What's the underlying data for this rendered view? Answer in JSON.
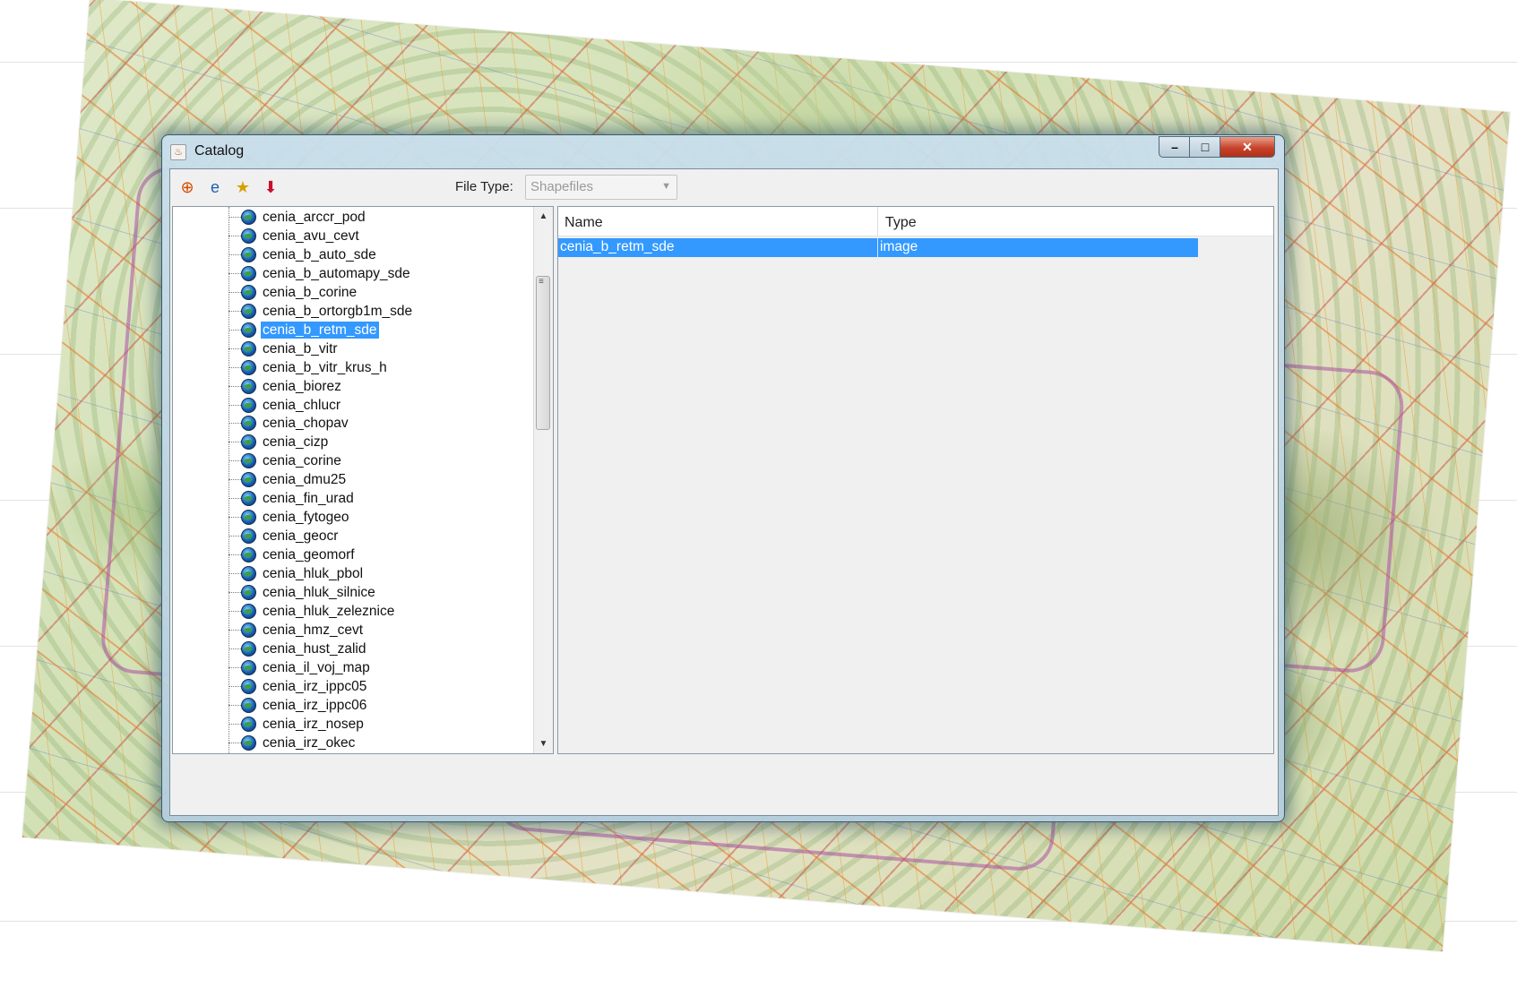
{
  "window": {
    "title": "Catalog",
    "controls": {
      "minimize": "–",
      "maximize": "□",
      "close": "✕"
    }
  },
  "toolbar": {
    "buttons": [
      {
        "name": "add-layer-icon",
        "glyph": "⊕",
        "color": "#d24a00"
      },
      {
        "name": "web-service-icon",
        "glyph": "e",
        "color": "#1c5fb4"
      },
      {
        "name": "new-folder-icon",
        "glyph": "★",
        "color": "#d6a000"
      },
      {
        "name": "export-icon",
        "glyph": "⬇",
        "color": "#c8102e"
      }
    ],
    "file_type_label": "File Type:",
    "file_type_value": "Shapefiles"
  },
  "tree": {
    "items": [
      "cenia_arccr_pod",
      "cenia_avu_cevt",
      "cenia_b_auto_sde",
      "cenia_b_automapy_sde",
      "cenia_b_corine",
      "cenia_b_ortorgb1m_sde",
      "cenia_b_retm_sde",
      "cenia_b_vitr",
      "cenia_b_vitr_krus_h",
      "cenia_biorez",
      "cenia_chlucr",
      "cenia_chopav",
      "cenia_cizp",
      "cenia_corine",
      "cenia_dmu25",
      "cenia_fin_urad",
      "cenia_fytogeo",
      "cenia_geocr",
      "cenia_geomorf",
      "cenia_hluk_pbol",
      "cenia_hluk_silnice",
      "cenia_hluk_zeleznice",
      "cenia_hmz_cevt",
      "cenia_hust_zalid",
      "cenia_il_voj_map",
      "cenia_irz_ippc05",
      "cenia_irz_ippc06",
      "cenia_irz_nosep",
      "cenia_irz_okec"
    ],
    "selected_index": 6
  },
  "table": {
    "columns": [
      "Name",
      "Type"
    ],
    "rows": [
      {
        "name": "cenia_b_retm_sde",
        "type": "image"
      }
    ]
  },
  "colors": {
    "selection": "#3399ff",
    "close_button": "#c8432c"
  }
}
